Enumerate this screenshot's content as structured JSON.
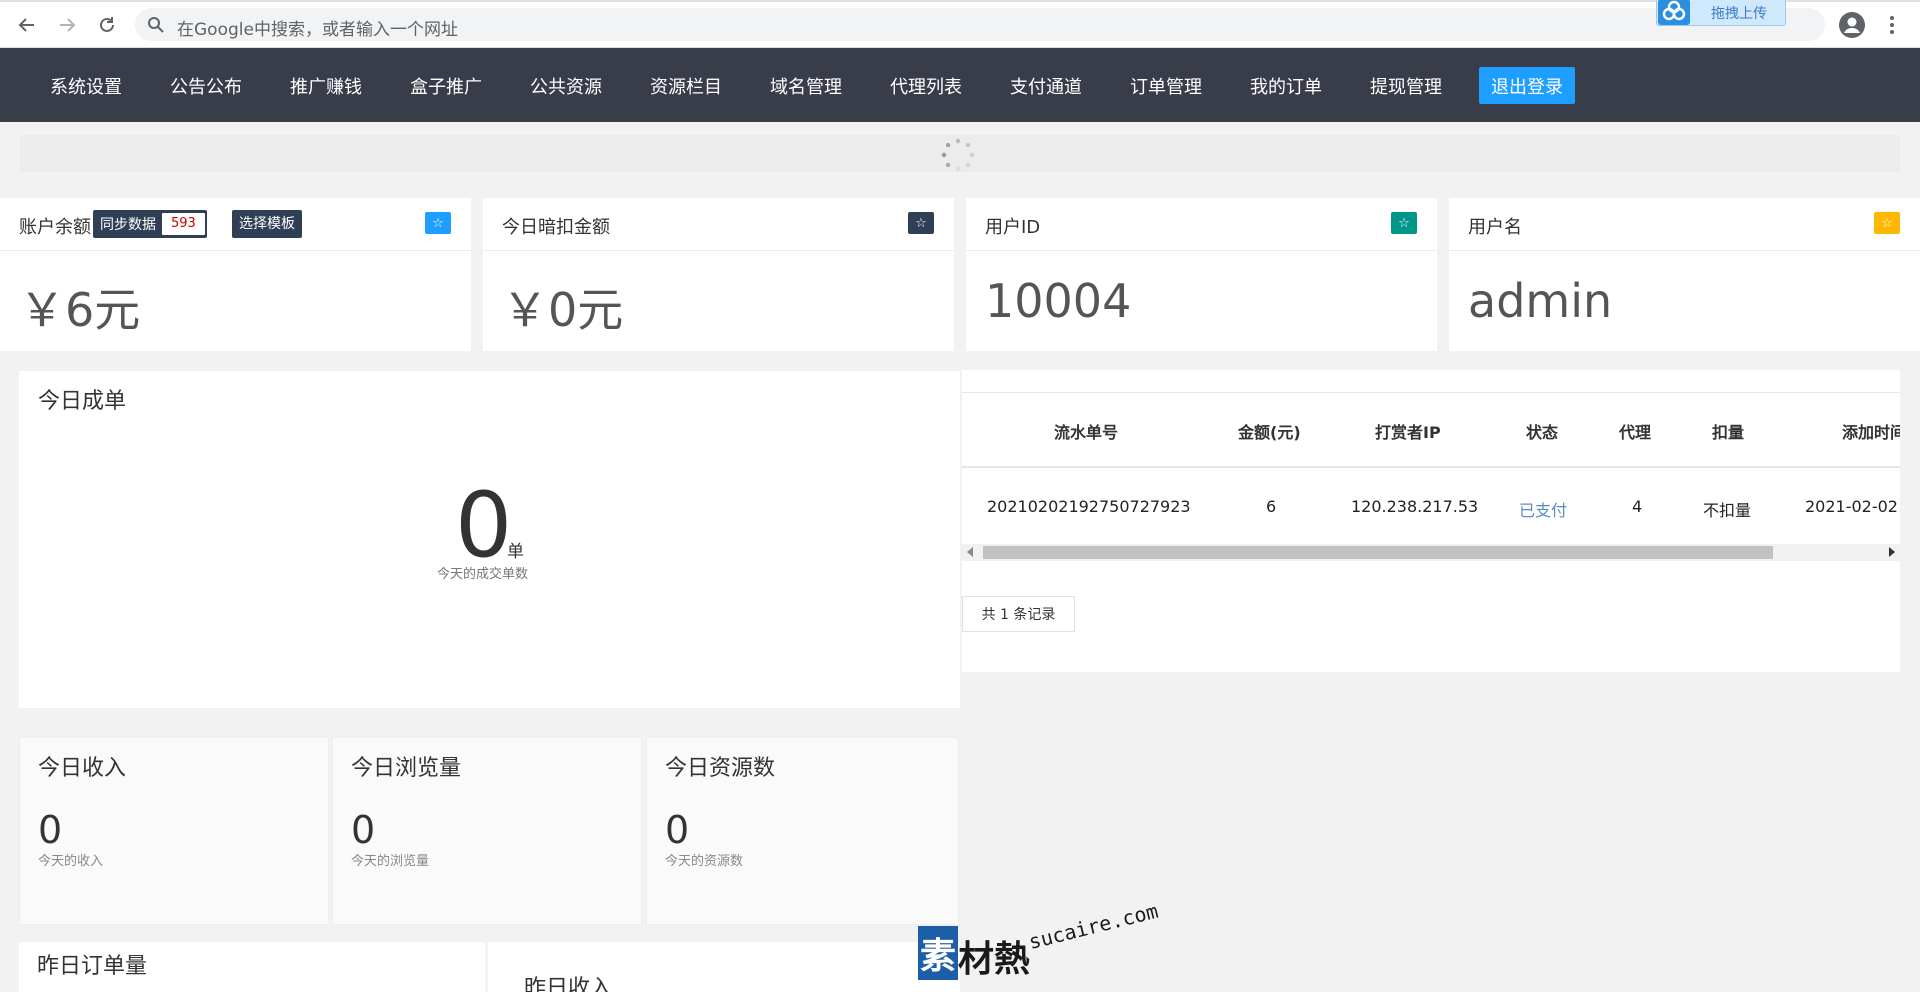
{
  "browser": {
    "omnibox_placeholder": "在Google中搜索，或者输入一个网址",
    "extension_label": "拖拽上传"
  },
  "nav": {
    "items": [
      "系统设置",
      "公告公布",
      "推广赚钱",
      "盒子推广",
      "公共资源",
      "资源栏目",
      "域名管理",
      "代理列表",
      "支付通道",
      "订单管理",
      "我的订单",
      "提现管理"
    ],
    "logout": "退出登录"
  },
  "stats": {
    "balance": {
      "title": "账户余额",
      "sync_label": "同步数据",
      "sync_count": "593",
      "template_label": "选择模板",
      "value": "￥6元",
      "badge_color": "#1e9fff"
    },
    "hidden_deduct": {
      "title": "今日暗扣金额",
      "value": "￥0元",
      "badge_color": "#2f4056"
    },
    "user_id": {
      "title": "用户ID",
      "value": "10004",
      "badge_color": "#009688"
    },
    "username": {
      "title": "用户名",
      "value": "admin",
      "badge_color": "#ffb800"
    }
  },
  "today_orders": {
    "title": "今日成单",
    "value": "0",
    "unit": "单",
    "desc": "今天的成交单数"
  },
  "mini": [
    {
      "title": "今日收入",
      "value": "0",
      "desc": "今天的收入"
    },
    {
      "title": "今日浏览量",
      "value": "0",
      "desc": "今天的浏览量"
    },
    {
      "title": "今日资源数",
      "value": "0",
      "desc": "今天的资源数"
    }
  ],
  "orders_table": {
    "headers": [
      "流水单号",
      "金额(元)",
      "打赏者IP",
      "状态",
      "代理",
      "扣量",
      "添加时间"
    ],
    "rows": [
      [
        "20210202192750727923",
        "6",
        "120.238.217.53",
        "已支付",
        "4",
        "不扣量",
        "2021-02-02"
      ]
    ],
    "record_count": "共 1 条记录"
  },
  "bottom": {
    "yesterday_orders": "昨日订单量",
    "yesterday_income": "昨日收入"
  },
  "watermark": {
    "cn_box": "素",
    "cn_rest": "材熱",
    "en": "sucaire.com"
  }
}
